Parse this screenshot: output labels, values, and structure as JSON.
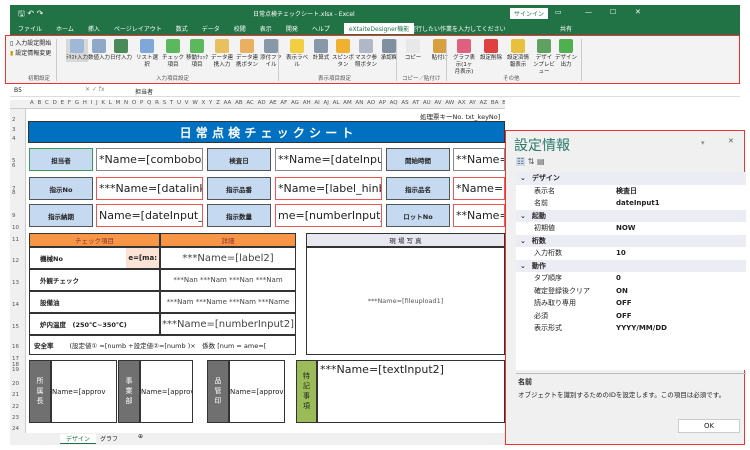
{
  "window": {
    "title": "日常点検チェックシート.xlsx - Excel",
    "signin": "サインイン",
    "share": "共有",
    "controls": [
      "▭",
      "—",
      "☐",
      "✕"
    ]
  },
  "tabs": [
    "ファイル",
    "ホーム",
    "挿入",
    "ページレイアウト",
    "数式",
    "データ",
    "校閲",
    "表示",
    "開発",
    "ヘルプ",
    "eXtaiteDesigner機能"
  ],
  "tell_me": "実行したい作業を入力してください",
  "ribbon": {
    "init": [
      "入力設定開始",
      "設定情報変更"
    ],
    "buttons": [
      {
        "label": "ﾃｷｽﾄ入力",
        "color": "#9fb8d8"
      },
      {
        "label": "数値入力",
        "color": "#8fa8c8"
      },
      {
        "label": "日付入力",
        "color": "#4a8a5a"
      },
      {
        "label": "リスト選択",
        "color": "#7fa8d8"
      },
      {
        "label": "チェック項目",
        "color": "#5cb85c"
      },
      {
        "label": "移動ﾁｪｯｸ項目",
        "color": "#5cb85c"
      },
      {
        "label": "データ連携入力",
        "color": "#e8c060"
      },
      {
        "label": "データ連携ボタン",
        "color": "#e8b060"
      },
      {
        "label": "添付ファイル",
        "color": "#8898a8"
      },
      {
        "label": "表示ラベル",
        "color": "#f0d040"
      },
      {
        "label": "計算式",
        "color": "#8898a8"
      },
      {
        "label": "スピンボタン",
        "color": "#f0b030"
      },
      {
        "label": "マスク参照ボタン",
        "color": "#b0b8c8"
      },
      {
        "label": "承認欄",
        "color": "#8090a0"
      },
      {
        "label": "コピー",
        "color": "#e8e8e8"
      },
      {
        "label": "貼付け",
        "color": "#d8a040"
      },
      {
        "label": "グラフ表示(1ヶ月表示)",
        "color": "#e06080"
      },
      {
        "label": "設定削除",
        "color": "#e04040"
      },
      {
        "label": "設定済情報表示",
        "color": "#e8c040"
      },
      {
        "label": "デザインプレビュー",
        "color": "#60a060"
      },
      {
        "label": "デザイン出力",
        "color": "#50b050"
      }
    ],
    "groups": [
      "初期設定",
      "入力項目設定",
      "表示項目設定",
      "コピー／貼付け",
      "その他"
    ]
  },
  "formula": {
    "cell": "B5",
    "value": "担当者"
  },
  "columns": "A B C D E F G H I J K L M N O P Q R S T U V W X Y Z AA AB AC AD AE AF AG AH AI AJ AL AM AN AO AP AQ AS AT AU AV AW AX AY AZ BA BB BC BD",
  "sheet": {
    "key_label": "処理票キーNo.  txt_keyNo]",
    "title": "日 常 点 検 チ ェ ッ ク シ ー ト",
    "labels": [
      "担当者",
      "検査日",
      "開始時間",
      "指示No",
      "指示品番",
      "指示品名",
      "指示納期",
      "指示数量",
      "ロットNo"
    ],
    "fields": [
      "*Name=[combobox",
      "**Name=[dateInput1",
      "**Name=[",
      "***Name=[datalink1",
      "*Name=[label_hinban",
      "*Name=[",
      "Name=[dateInput_nouki",
      "me=[numberInput_",
      "**Name=["
    ],
    "check_header": "チェック項目",
    "detail_header": "詳細",
    "photo_header": "現 場 写 真",
    "rows": [
      {
        "item": "機械No",
        "extra": "e=[ma:",
        "detail": "***Name=[label2]"
      },
      {
        "item": "外観チェック",
        "detail": "***Nan ***Nam ***Nan ***Nam"
      },
      {
        "item": "設備油",
        "detail": "***Nam ***Name ***Nam ***Name"
      },
      {
        "item": "炉内温度　(250℃~350℃)",
        "detail": "***Name=[numberInput2]"
      }
    ],
    "safety_label": "安全率",
    "safety_formula": "(設定値① =[numb +設定値②=[numb )×　係数 [num = ame=[",
    "photo": "***Name=[fileupload1]",
    "approvals": [
      {
        "label": "所属長",
        "value": "Name=[approv"
      },
      {
        "label": "事業部",
        "value": "Name=[approv"
      },
      {
        "label": "品管印",
        "value": "Name=[approv"
      }
    ],
    "notes_label": "特記事項",
    "notes": "***Name=[textInput2]",
    "row_numbers": [
      "2",
      "3",
      "4",
      "5",
      "6",
      "7",
      "8",
      "9",
      "10",
      "11",
      "12",
      "13",
      "14",
      "15",
      "16",
      "17",
      "18",
      "19",
      "20",
      "21",
      "22",
      "23",
      "24"
    ]
  },
  "sheet_tabs": [
    "デザイン",
    "グラフ"
  ],
  "panel": {
    "title": "設定情報",
    "categories": [
      {
        "name": "デザイン",
        "props": [
          [
            "表示名",
            "検査日"
          ],
          [
            "名前",
            "dateInput1"
          ]
        ]
      },
      {
        "name": "起動",
        "props": [
          [
            "初期値",
            "NOW"
          ]
        ]
      },
      {
        "name": "桁数",
        "props": [
          [
            "入力桁数",
            "10"
          ]
        ]
      },
      {
        "name": "動作",
        "props": [
          [
            "タブ順序",
            "0"
          ],
          [
            "確定登録後クリア",
            "ON"
          ],
          [
            "読み取り専用",
            "OFF"
          ],
          [
            "必須",
            "OFF"
          ],
          [
            "表示形式",
            "YYYY/MM/DD"
          ]
        ]
      }
    ],
    "desc_title": "名前",
    "desc": "オブジェクトを識別するためのIDを設定します。この項目は必須です。",
    "ok": "OK"
  },
  "colors": {
    "excel_green": "#217346",
    "title_blue": "#0070c0",
    "orange": "#f79646",
    "highlight": "#e33333"
  }
}
